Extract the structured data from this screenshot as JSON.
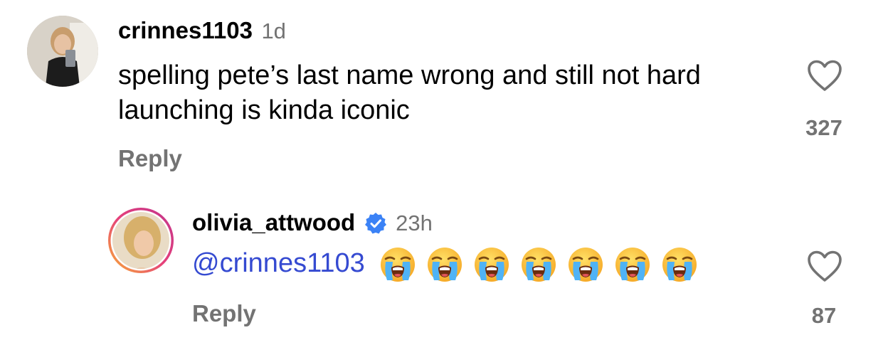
{
  "comments": [
    {
      "username": "crinnes1103",
      "time": "1d",
      "text": "spelling pete’s last name wrong and still not hard launching is kinda iconic",
      "reply_label": "Reply",
      "like_count": "327"
    },
    {
      "username": "olivia_attwood",
      "verified": true,
      "time": "23h",
      "mention": "@crinnes1103",
      "emoji_count": 7,
      "emoji_name": "loudly-crying-face",
      "reply_label": "Reply",
      "like_count": "87"
    }
  ],
  "colors": {
    "secondary_text": "#737373",
    "mention": "#354ad1",
    "verified_badge": "#3b82f6",
    "story_ring_start": "#f9b233",
    "story_ring_end": "#c1358c"
  }
}
